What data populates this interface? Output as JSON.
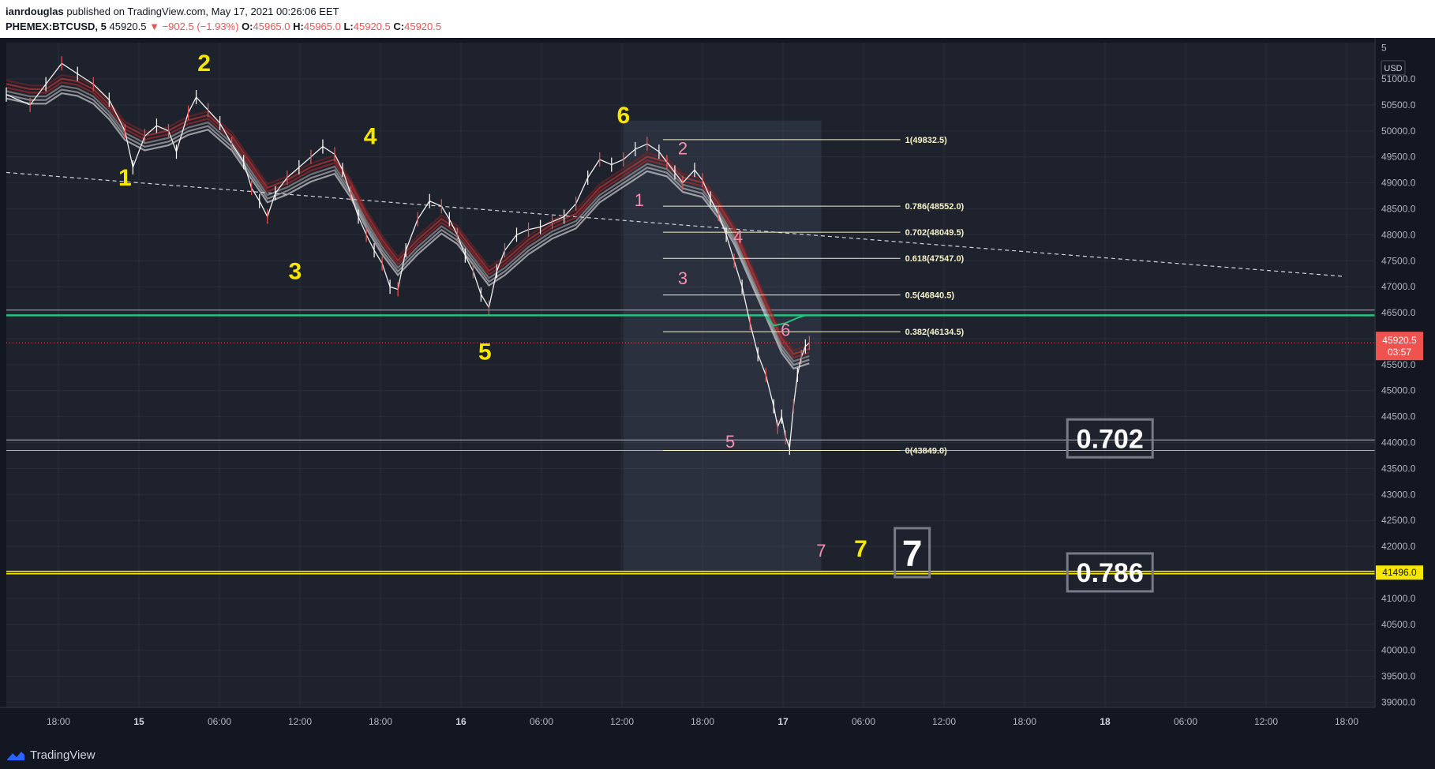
{
  "header": {
    "author": "ianrdouglas",
    "published": "published on TradingView.com, May 17, 2021 00:26:06 EET",
    "symbol": "PHEMEX:BTCUSD, 5",
    "last": "45920.5",
    "change": "▼ −902.5 (−1.93%)",
    "o_label": "O:",
    "o": "45965.0",
    "h_label": "H:",
    "h": "45965.0",
    "l_label": "L:",
    "l": "45920.5",
    "c_label": "C:",
    "c": "45920.5"
  },
  "footer": {
    "brand": "TradingView"
  },
  "chart_data": {
    "type": "line",
    "currency": "USD",
    "last_price": 45920.5,
    "last_price_label": "45920.5",
    "countdown": "03:57",
    "ylim": [
      38900,
      51700
    ],
    "y_ticks": [
      39000,
      39500,
      40000,
      40500,
      41000,
      41500,
      42000,
      42500,
      43000,
      43500,
      44000,
      44500,
      45000,
      45500,
      46000,
      46500,
      47000,
      47500,
      48000,
      48500,
      49000,
      49500,
      50000,
      50500,
      51000
    ],
    "y_top_tick_label": "5",
    "x_ticks": [
      "18:00",
      "15",
      "06:00",
      "12:00",
      "18:00",
      "16",
      "06:00",
      "12:00",
      "18:00",
      "17",
      "06:00",
      "12:00",
      "18:00",
      "18",
      "06:00",
      "12:00",
      "18:00"
    ],
    "price_series": [
      [
        0,
        50700
      ],
      [
        6,
        50500
      ],
      [
        10,
        50900
      ],
      [
        14,
        51300
      ],
      [
        18,
        51100
      ],
      [
        22,
        50900
      ],
      [
        26,
        50600
      ],
      [
        30,
        50000
      ],
      [
        32,
        49300
      ],
      [
        35,
        49900
      ],
      [
        38,
        50100
      ],
      [
        41,
        50000
      ],
      [
        43,
        49600
      ],
      [
        46,
        50350
      ],
      [
        48,
        50650
      ],
      [
        51,
        50400
      ],
      [
        54,
        50150
      ],
      [
        57,
        49750
      ],
      [
        60,
        49400
      ],
      [
        62,
        48900
      ],
      [
        64,
        48650
      ],
      [
        66,
        48350
      ],
      [
        68,
        48800
      ],
      [
        71,
        49100
      ],
      [
        74,
        49300
      ],
      [
        77,
        49500
      ],
      [
        80,
        49700
      ],
      [
        83,
        49550
      ],
      [
        85,
        49250
      ],
      [
        87,
        48800
      ],
      [
        89,
        48350
      ],
      [
        91,
        48000
      ],
      [
        93,
        47700
      ],
      [
        95,
        47450
      ],
      [
        97,
        47000
      ],
      [
        99,
        46950
      ],
      [
        101,
        47700
      ],
      [
        104,
        48300
      ],
      [
        107,
        48650
      ],
      [
        110,
        48550
      ],
      [
        112,
        48300
      ],
      [
        114,
        48000
      ],
      [
        116,
        47600
      ],
      [
        118,
        47300
      ],
      [
        120,
        46850
      ],
      [
        122,
        46600
      ],
      [
        124,
        47300
      ],
      [
        126,
        47700
      ],
      [
        129,
        48000
      ],
      [
        132,
        48100
      ],
      [
        135,
        48150
      ],
      [
        138,
        48250
      ],
      [
        141,
        48350
      ],
      [
        144,
        48600
      ],
      [
        147,
        49100
      ],
      [
        150,
        49450
      ],
      [
        153,
        49350
      ],
      [
        156,
        49450
      ],
      [
        159,
        49650
      ],
      [
        162,
        49750
      ],
      [
        165,
        49600
      ],
      [
        167,
        49400
      ],
      [
        169,
        49200
      ],
      [
        171,
        49000
      ],
      [
        174,
        49250
      ],
      [
        176,
        49050
      ],
      [
        178,
        48700
      ],
      [
        180,
        48400
      ],
      [
        182,
        48000
      ],
      [
        184,
        47500
      ],
      [
        186,
        47000
      ],
      [
        188,
        46300
      ],
      [
        190,
        45700
      ],
      [
        192,
        45300
      ],
      [
        194,
        44700
      ],
      [
        195,
        44300
      ],
      [
        196,
        44500
      ],
      [
        197,
        44100
      ],
      [
        198,
        43900
      ],
      [
        199,
        44700
      ],
      [
        200,
        45300
      ],
      [
        201,
        45650
      ],
      [
        202,
        45850
      ],
      [
        203,
        45920
      ]
    ],
    "ema_ribbon": [
      [
        0,
        50800
      ],
      [
        6,
        50700
      ],
      [
        10,
        50700
      ],
      [
        14,
        50900
      ],
      [
        18,
        50850
      ],
      [
        22,
        50700
      ],
      [
        26,
        50400
      ],
      [
        30,
        50000
      ],
      [
        35,
        49800
      ],
      [
        41,
        49900
      ],
      [
        46,
        50100
      ],
      [
        51,
        50200
      ],
      [
        57,
        49800
      ],
      [
        62,
        49250
      ],
      [
        66,
        48800
      ],
      [
        71,
        48950
      ],
      [
        77,
        49200
      ],
      [
        83,
        49350
      ],
      [
        87,
        48900
      ],
      [
        91,
        48300
      ],
      [
        95,
        47800
      ],
      [
        99,
        47400
      ],
      [
        104,
        47800
      ],
      [
        110,
        48200
      ],
      [
        114,
        48000
      ],
      [
        118,
        47600
      ],
      [
        122,
        47200
      ],
      [
        126,
        47400
      ],
      [
        132,
        47800
      ],
      [
        138,
        48100
      ],
      [
        144,
        48300
      ],
      [
        150,
        48800
      ],
      [
        156,
        49100
      ],
      [
        162,
        49400
      ],
      [
        167,
        49300
      ],
      [
        171,
        49000
      ],
      [
        176,
        48900
      ],
      [
        180,
        48500
      ],
      [
        184,
        48000
      ],
      [
        188,
        47300
      ],
      [
        192,
        46600
      ],
      [
        196,
        45900
      ],
      [
        199,
        45600
      ],
      [
        203,
        45700
      ]
    ],
    "time_highlight": {
      "start": 156,
      "end": 206
    },
    "fib": [
      {
        "label": "1(49832.5)",
        "price": 49832.5
      },
      {
        "label": "0.786(48552.0)",
        "price": 48552.0
      },
      {
        "label": "0.702(48049.5)",
        "price": 48049.5
      },
      {
        "label": "0.618(47547.0)",
        "price": 47547.0
      },
      {
        "label": "0.5(46840.5)",
        "price": 46840.5
      },
      {
        "label": "0.382(46134.5)",
        "price": 46134.5
      },
      {
        "label": "0(43849.0)",
        "price": 43849.0
      }
    ],
    "fib_x": [
      166,
      226
    ],
    "h_lines": [
      {
        "price": 46550,
        "color": "#b2b5be"
      },
      {
        "price": 46450,
        "color": "#26c281"
      },
      {
        "price": 44050,
        "color": "#b2b5be"
      },
      {
        "price": 43849,
        "color": "#b2b5be"
      }
    ],
    "support": {
      "price": 41496.0,
      "label": "41496.0"
    },
    "trendline": [
      [
        0,
        49200
      ],
      [
        338,
        47200
      ]
    ],
    "last_price_line": 45920.5,
    "wave_yellow": [
      {
        "t": "1",
        "x": 30,
        "p": 48950
      },
      {
        "t": "2",
        "x": 50,
        "p": 51150
      },
      {
        "t": "3",
        "x": 73,
        "p": 47150
      },
      {
        "t": "4",
        "x": 92,
        "p": 49750
      },
      {
        "t": "5",
        "x": 121,
        "p": 45600
      },
      {
        "t": "6",
        "x": 156,
        "p": 50150
      },
      {
        "t": "7",
        "x": 216,
        "p": 41800
      }
    ],
    "wave_pink": [
      {
        "t": "2",
        "x": 171,
        "p": 49550
      },
      {
        "t": "1",
        "x": 160,
        "p": 48550
      },
      {
        "t": "4",
        "x": 185,
        "p": 47850
      },
      {
        "t": "3",
        "x": 171,
        "p": 47050
      },
      {
        "t": "6",
        "x": 197,
        "p": 46050
      },
      {
        "t": "5",
        "x": 183,
        "p": 43900
      },
      {
        "t": "7",
        "x": 206,
        "p": 41800
      }
    ],
    "boxes": [
      {
        "t": "0.702",
        "x": 279,
        "p": 44080,
        "size": 34
      },
      {
        "t": "0.786",
        "x": 279,
        "p": 41500,
        "size": 34
      },
      {
        "t": "7",
        "x": 229,
        "p": 41880,
        "size": 46
      }
    ]
  }
}
